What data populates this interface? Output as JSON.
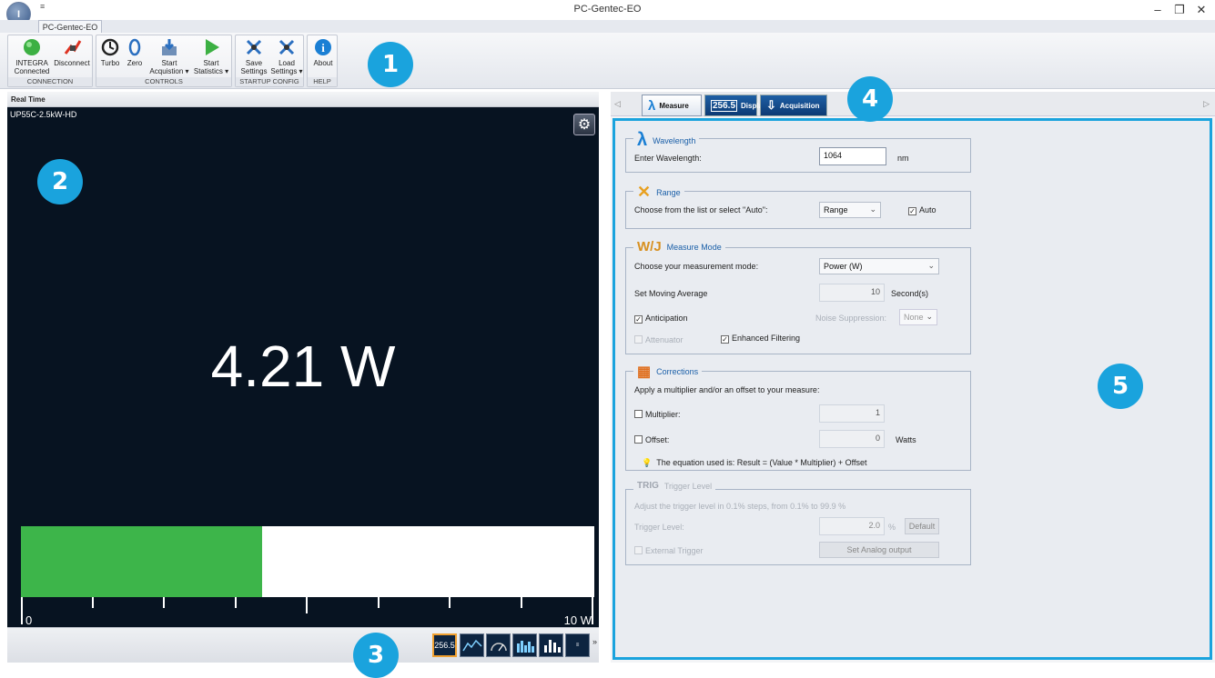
{
  "window": {
    "title": "PC-Gentec-EO",
    "orb_label": "I",
    "qat_symbol": "≡",
    "controls": {
      "minimize": "–",
      "restore": "❐",
      "close": "✕"
    }
  },
  "ribbon": {
    "tab": "PC-Gentec-EO",
    "groups": {
      "connection": "CONNECTION",
      "controls": "CONTROLS",
      "startup": "STARTUP CONFIG",
      "help": "HELP"
    },
    "buttons": {
      "integra_l1": "INTEGRA",
      "integra_l2": "Connected",
      "disconnect": "Disconnect",
      "turbo": "Turbo",
      "zero": "Zero",
      "start_acq_l1": "Start",
      "start_acq_l2": "Acquistion ▾",
      "start_stats_l1": "Start",
      "start_stats_l2": "Statistics ▾",
      "save_l1": "Save",
      "save_l2": "Settings",
      "load_l1": "Load",
      "load_l2": "Settings ▾",
      "about": "About"
    }
  },
  "callouts": [
    "1",
    "2",
    "3",
    "4",
    "5"
  ],
  "realtime": {
    "header": "Real Time",
    "device": "UP55C-2.5kW-HD",
    "value": "4.21 W",
    "bar_fraction": 0.421,
    "scale_min": "0",
    "scale_max": "10 W"
  },
  "view_buttons": [
    "256.5",
    "line-chart",
    "gauge",
    "histogram",
    "bar-chart",
    "statistics"
  ],
  "view_label": "256.5",
  "view_more": "»",
  "tabs": {
    "measure": "Measure",
    "display": "Display",
    "acquisition": "Acquisition",
    "display_badge": "256.5"
  },
  "wavelength": {
    "title": "Wavelength",
    "label": "Enter Wavelength:",
    "value": "1064",
    "unit": "nm"
  },
  "range": {
    "title": "Range",
    "label": "Choose from the list or select \"Auto\":",
    "selected": "Range",
    "auto": "Auto"
  },
  "measure_mode": {
    "title": "Measure Mode",
    "icon_text": "W/J",
    "mode_label": "Choose your measurement mode:",
    "mode_selected": "Power (W)",
    "avg_label": "Set Moving Average",
    "avg_value": "10",
    "avg_unit": "Second(s)",
    "anticipation": "Anticipation",
    "noise_label": "Noise Suppression:",
    "noise_value": "None",
    "attenuator": "Attenuator",
    "enhanced": "Enhanced Filtering"
  },
  "corrections": {
    "title": "Corrections",
    "desc": "Apply a multiplier and/or an offset to your measure:",
    "multiplier_label": "Multiplier:",
    "multiplier_value": "1",
    "offset_label": "Offset:",
    "offset_value": "0",
    "offset_unit": "Watts",
    "equation": "The equation used is: Result = (Value * Multiplier) + Offset"
  },
  "trigger": {
    "title": "Trigger Level",
    "icon_text": "TRIG",
    "desc": "Adjust the trigger level in 0.1% steps, from 0.1% to 99.9 %",
    "level_label": "Trigger Level:",
    "level_value": "2.0",
    "level_unit": "%",
    "default_btn": "Default",
    "external": "External Trigger",
    "analog_btn": "Set Analog output"
  }
}
